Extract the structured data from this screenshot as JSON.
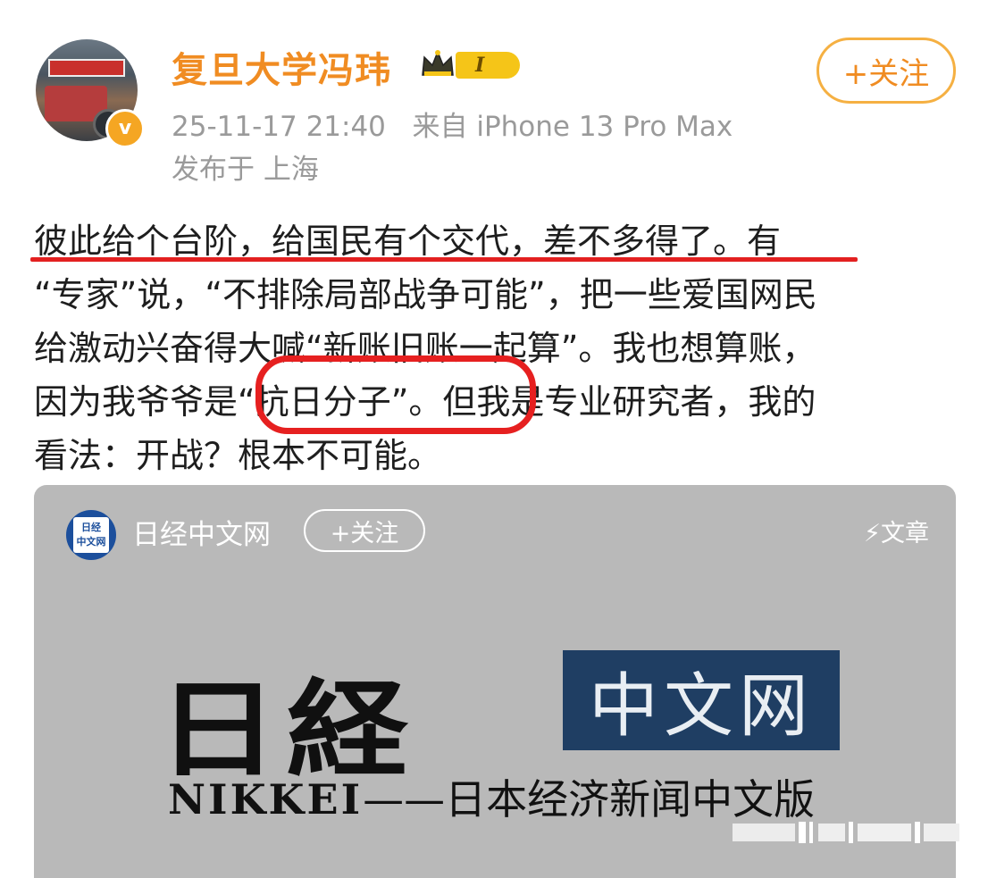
{
  "post": {
    "author": {
      "name": "复旦大学冯玮",
      "level_badge": "I",
      "verified_icon": "v-badge-icon"
    },
    "follow_label": "+关注",
    "timestamp": "25-11-17 21:40",
    "source": "来自 iPhone 13 Pro Max",
    "location": "发布于 上海",
    "body_lines": [
      "彼此给个台阶，给国民有个交代，差不多得了。有",
      "“专家”说，“不排除局部战争可能”，把一些爱国网民",
      "给激动兴奋得大喊“新账旧账一起算”。我也想算账，",
      "因为我爷爷是“抗日分子”。但我是专业研究者，我的",
      "看法：开战？根本不可能。"
    ]
  },
  "shared_card": {
    "source_name": "日经中文网",
    "follow_label": "+关注",
    "type_label": "⚡文章",
    "logo_lines": [
      "日经",
      "中文网"
    ],
    "banner": {
      "kanji": "日経",
      "cn": "中文网",
      "en": "NIKKEI",
      "tagline": "——日本经济新闻中文版"
    }
  },
  "colors": {
    "username": "#f08c22",
    "follow_border": "#f5b042",
    "annotation_red": "#e32020",
    "card_bg": "#b9b9b9",
    "nikkei_blue": "#1f3e63"
  }
}
